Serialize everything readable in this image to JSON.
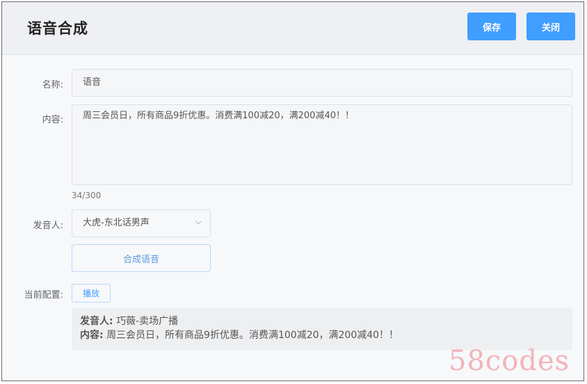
{
  "dialog": {
    "title": "语音合成",
    "save_label": "保存",
    "close_label": "关闭"
  },
  "form": {
    "name": {
      "label": "名称:",
      "value": "语音"
    },
    "content": {
      "label": "内容:",
      "value": "周三会员日，所有商品9折优惠。消费满100减20，满200减40！！",
      "counter": "34/300"
    },
    "speaker": {
      "label": "发音人:",
      "selected": "大虎-东北话男声"
    },
    "synthesize_label": "合成语音",
    "current_config": {
      "label": "当前配置:",
      "play_label": "播放",
      "speaker_key": "发音人:",
      "speaker_value": "巧薇-卖场广播",
      "content_key": "内容:",
      "content_value": "周三会员日，所有商品9折优惠。消费满100减20，满200减40！！"
    }
  },
  "watermark": "58codes",
  "colors": {
    "primary": "#409eff",
    "header_bg": "#eef0f3",
    "body_bg": "#f7f8fa",
    "watermark": "#f3b3b8"
  }
}
